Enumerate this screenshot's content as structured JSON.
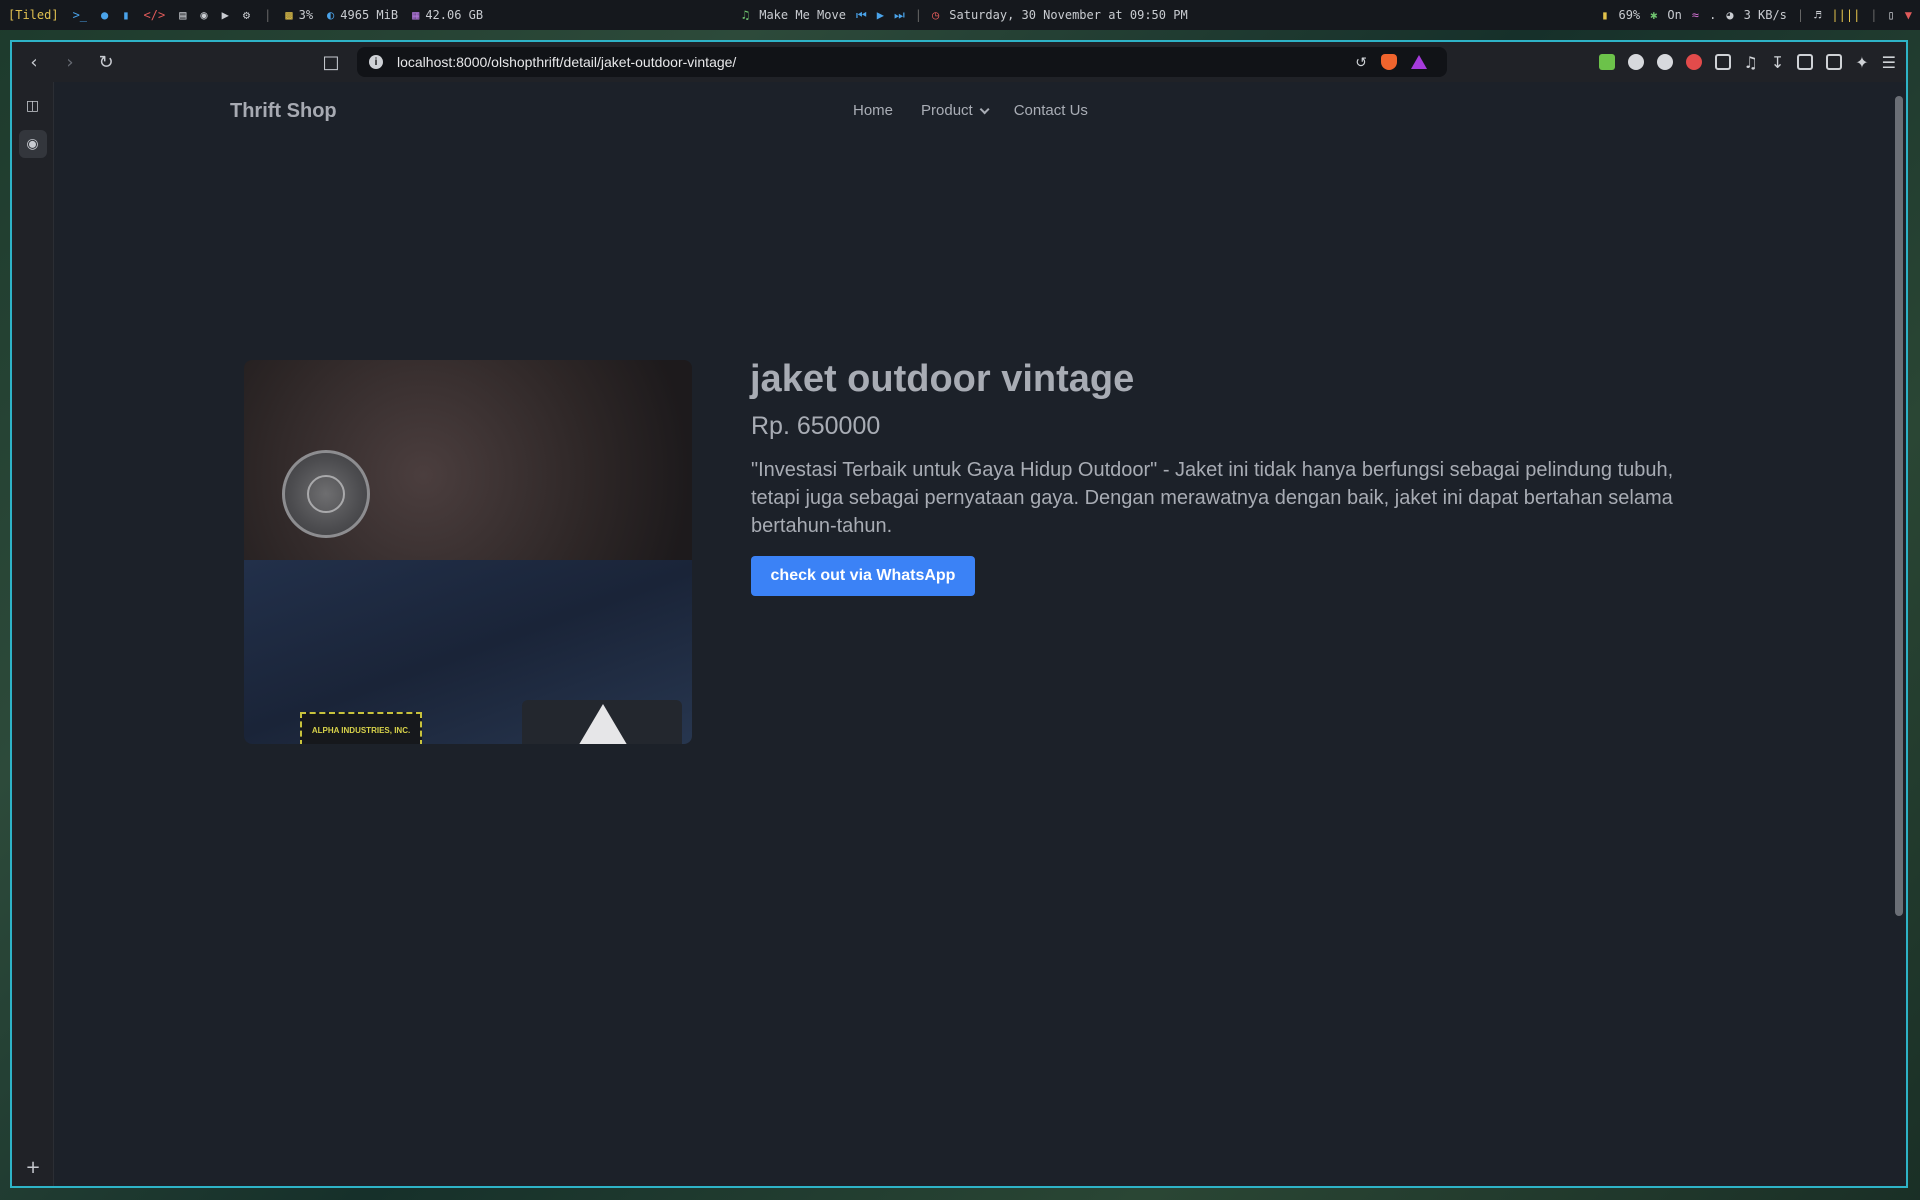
{
  "system_bar": {
    "workspace_mode": "[Tiled]",
    "cpu": "3%",
    "memory": "4965 MiB",
    "disk": "42.06 GB",
    "media_title": "Make Me Move",
    "datetime": "Saturday, 30 November at 09:50 PM",
    "battery": "69%",
    "bluetooth": "On",
    "wifi": ".",
    "net_speed": "3 KB/s"
  },
  "browser": {
    "url": "localhost:8000/olshopthrift/detail/jaket-outdoor-vintage/"
  },
  "site": {
    "brand": "Thrift Shop",
    "nav": {
      "home": "Home",
      "product": "Product",
      "contact": "Contact Us"
    }
  },
  "product": {
    "name": "jaket outdoor vintage",
    "price": "Rp. 650000",
    "description": "\"Investasi Terbaik untuk Gaya Hidup Outdoor\" - Jaket ini tidak hanya berfungsi sebagai pelindung tubuh, tetapi juga sebagai pernyataan gaya. Dengan merawatnya dengan baik, jaket ini dapat bertahan selama bertahun-tahun.",
    "checkout_label": "check out via WhatsApp",
    "photo_label_text": "ALPHA INDUSTRIES, INC."
  },
  "colors": {
    "accent_button": "#3b82f6",
    "page_bg": "#1c2129",
    "window_border": "#2eb3c7"
  }
}
